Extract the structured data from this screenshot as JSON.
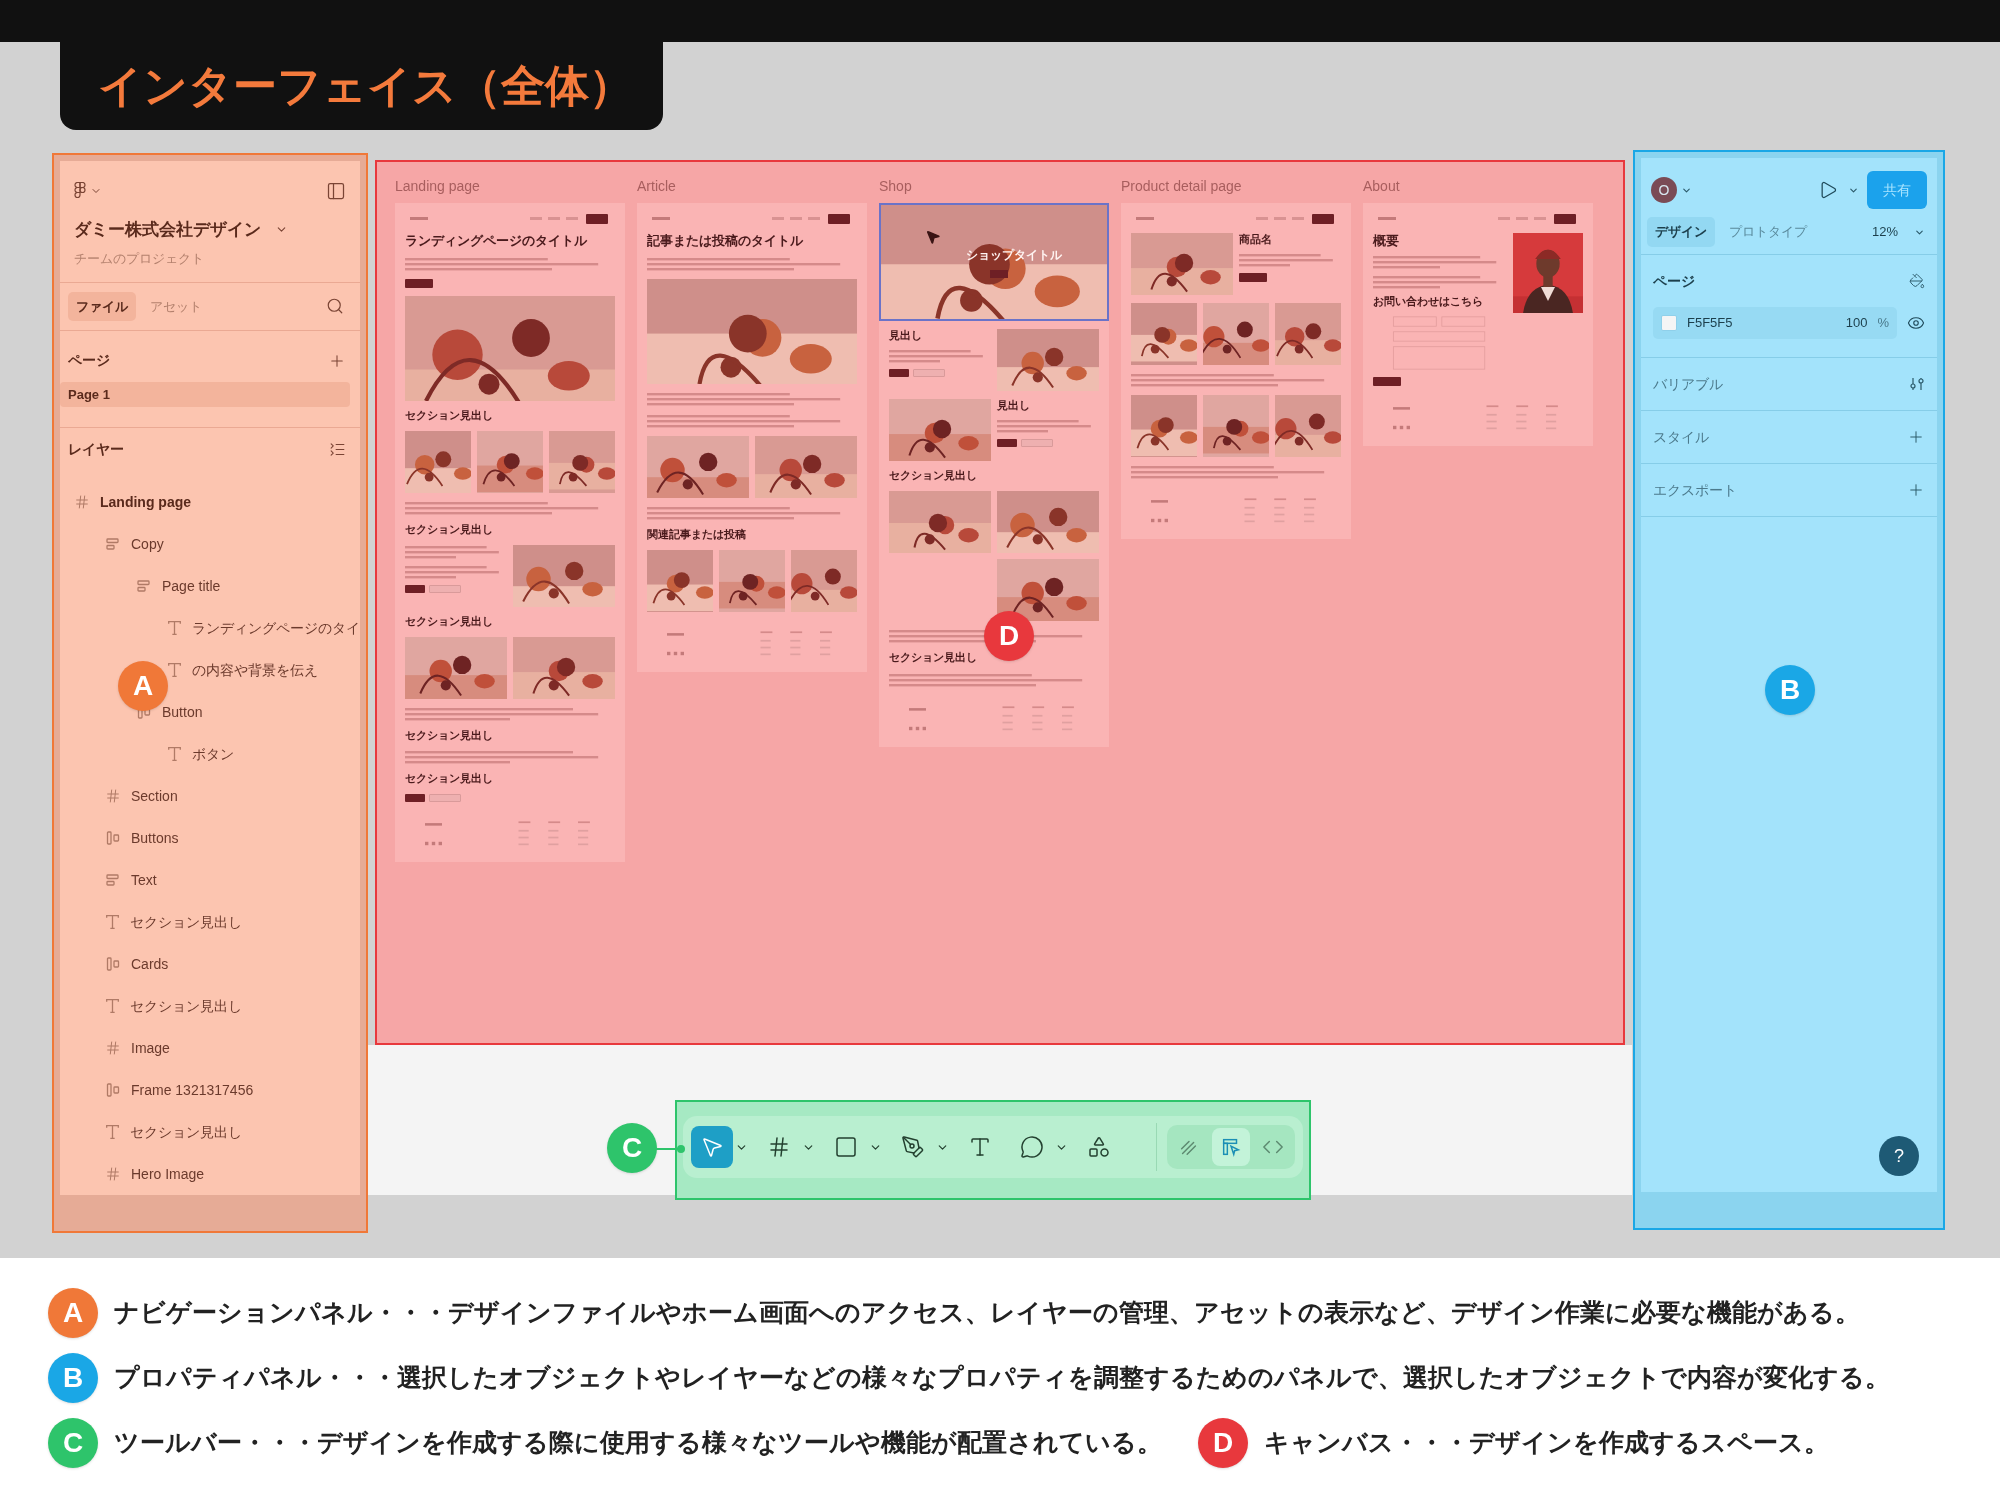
{
  "header": {
    "title": "インターフェイス（全体）"
  },
  "nav_panel": {
    "team": "ダミー株式会社デザイン",
    "project": "チームのプロジェクト",
    "tabs": [
      {
        "label": "ファイル",
        "selected": true
      },
      {
        "label": "アセット",
        "selected": false
      }
    ],
    "pages_title": "ページ",
    "pages": [
      {
        "label": "Page 1",
        "selected": true
      }
    ],
    "layers_title": "レイヤー",
    "layers": [
      {
        "name": "Landing page",
        "kind": "frame",
        "children": [
          {
            "name": "Copy",
            "kind": "stack",
            "children": [
              {
                "name": "Page title",
                "kind": "stack",
                "children": [
                  {
                    "name": "ランディングページのタイ",
                    "kind": "text"
                  },
                  {
                    "name": "の内容や背景を伝え",
                    "kind": "text"
                  }
                ]
              },
              {
                "name": "Button",
                "kind": "row",
                "children": [
                  {
                    "name": "ボタン",
                    "kind": "text"
                  }
                ]
              }
            ]
          },
          {
            "name": "Section",
            "kind": "frame"
          },
          {
            "name": "Buttons",
            "kind": "row"
          },
          {
            "name": "Text",
            "kind": "stack"
          },
          {
            "name": "セクション見出し",
            "kind": "text"
          },
          {
            "name": "Cards",
            "kind": "row"
          },
          {
            "name": "セクション見出し",
            "kind": "text"
          },
          {
            "name": "Image",
            "kind": "frame"
          },
          {
            "name": "Frame 1321317456",
            "kind": "row"
          },
          {
            "name": "セクション見出し",
            "kind": "text"
          },
          {
            "name": "Hero Image",
            "kind": "frame"
          }
        ]
      }
    ]
  },
  "canvas": {
    "frames": [
      {
        "label": "Landing page",
        "blocks": [
          {
            "kind": "nav"
          },
          {
            "kind": "title",
            "text": "ランディングページのタイトル"
          },
          {
            "kind": "text"
          },
          {
            "kind": "button"
          },
          {
            "kind": "picture"
          },
          {
            "kind": "heading",
            "text": "セクション見出し"
          },
          {
            "kind": "row",
            "items": [
              {
                "kind": "picture"
              },
              {
                "kind": "picture"
              },
              {
                "kind": "picture"
              }
            ]
          },
          {
            "kind": "text"
          },
          {
            "kind": "heading",
            "text": "セクション見出し"
          },
          {
            "kind": "row",
            "items": [
              {
                "kind": "column",
                "items": [
                  {
                    "kind": "text"
                  },
                  {
                    "kind": "text"
                  },
                  {
                    "kind": "buttons"
                  }
                ]
              },
              {
                "kind": "picture"
              }
            ]
          },
          {
            "kind": "heading",
            "text": "セクション見出し"
          },
          {
            "kind": "row",
            "items": [
              {
                "kind": "picture"
              },
              {
                "kind": "picture"
              }
            ]
          },
          {
            "kind": "text"
          },
          {
            "kind": "heading",
            "text": "セクション見出し"
          },
          {
            "kind": "text"
          },
          {
            "kind": "heading",
            "text": "セクション見出し"
          },
          {
            "kind": "buttons"
          },
          {
            "kind": "footer"
          }
        ]
      },
      {
        "label": "Article",
        "blocks": [
          {
            "kind": "nav"
          },
          {
            "kind": "title",
            "text": "記事または投稿のタイトル"
          },
          {
            "kind": "text"
          },
          {
            "kind": "picture"
          },
          {
            "kind": "text"
          },
          {
            "kind": "text"
          },
          {
            "kind": "row",
            "items": [
              {
                "kind": "picture"
              },
              {
                "kind": "picture"
              }
            ]
          },
          {
            "kind": "text"
          },
          {
            "kind": "heading",
            "text": "関連記事または投稿"
          },
          {
            "kind": "row",
            "items": [
              {
                "kind": "picture"
              },
              {
                "kind": "picture"
              },
              {
                "kind": "picture"
              }
            ]
          },
          {
            "kind": "footer"
          }
        ]
      },
      {
        "label": "Shop",
        "blocks": [
          {
            "kind": "hero",
            "text": "ショップタイトル",
            "selected": true
          },
          {
            "kind": "row",
            "items": [
              {
                "kind": "column",
                "items": [
                  {
                    "kind": "heading",
                    "text": "見出し"
                  },
                  {
                    "kind": "text"
                  },
                  {
                    "kind": "buttons"
                  }
                ]
              },
              {
                "kind": "picture"
              }
            ]
          },
          {
            "kind": "row",
            "items": [
              {
                "kind": "picture"
              },
              {
                "kind": "column",
                "items": [
                  {
                    "kind": "heading",
                    "text": "見出し"
                  },
                  {
                    "kind": "text"
                  },
                  {
                    "kind": "buttons"
                  }
                ]
              }
            ]
          },
          {
            "kind": "heading",
            "text": "セクション見出し"
          },
          {
            "kind": "row",
            "items": [
              {
                "kind": "picture"
              },
              {
                "kind": "column",
                "items": [
                  {
                    "kind": "picture"
                  },
                  {
                    "kind": "picture"
                  }
                ]
              }
            ]
          },
          {
            "kind": "text"
          },
          {
            "kind": "heading",
            "text": "セクション見出し"
          },
          {
            "kind": "text"
          },
          {
            "kind": "footer"
          }
        ]
      },
      {
        "label": "Product detail page",
        "blocks": [
          {
            "kind": "nav"
          },
          {
            "kind": "row",
            "items": [
              {
                "kind": "picture"
              },
              {
                "kind": "column",
                "items": [
                  {
                    "kind": "heading",
                    "text": "商品名"
                  },
                  {
                    "kind": "text"
                  },
                  {
                    "kind": "button"
                  }
                ]
              }
            ]
          },
          {
            "kind": "row",
            "items": [
              {
                "kind": "picture"
              },
              {
                "kind": "picture"
              },
              {
                "kind": "picture"
              }
            ]
          },
          {
            "kind": "text"
          },
          {
            "kind": "row",
            "items": [
              {
                "kind": "picture"
              },
              {
                "kind": "picture"
              },
              {
                "kind": "picture"
              }
            ]
          },
          {
            "kind": "text"
          },
          {
            "kind": "footer"
          }
        ]
      },
      {
        "label": "About",
        "blocks": [
          {
            "kind": "nav"
          },
          {
            "kind": "row",
            "items": [
              {
                "kind": "column",
                "items": [
                  {
                    "kind": "title",
                    "text": "概要"
                  },
                  {
                    "kind": "text"
                  },
                  {
                    "kind": "text"
                  },
                  {
                    "kind": "heading",
                    "text": "お問い合わせはこちら"
                  },
                  {
                    "kind": "form"
                  },
                  {
                    "kind": "button"
                  }
                ]
              },
              {
                "kind": "portrait"
              }
            ]
          },
          {
            "kind": "footer"
          }
        ]
      }
    ]
  },
  "toolbar": {
    "tools": [
      {
        "kind": "move",
        "selected": true,
        "menu": true
      },
      {
        "kind": "frame",
        "selected": false,
        "menu": true
      },
      {
        "kind": "shape",
        "selected": false,
        "menu": true
      },
      {
        "kind": "pen",
        "selected": false,
        "menu": true
      },
      {
        "kind": "text",
        "selected": false,
        "menu": false
      },
      {
        "kind": "comment",
        "selected": false,
        "menu": true
      },
      {
        "kind": "actions",
        "selected": false,
        "menu": false
      }
    ],
    "modes": [
      {
        "kind": "draw",
        "selected": false
      },
      {
        "kind": "design",
        "selected": true
      },
      {
        "kind": "dev",
        "selected": false
      }
    ]
  },
  "properties_panel": {
    "avatar": "O",
    "share": "共有",
    "tabs": [
      {
        "label": "デザイン",
        "selected": true
      },
      {
        "label": "プロトタイプ",
        "selected": false
      }
    ],
    "zoom": "12%",
    "page_section": {
      "title": "ページ",
      "color": "F5F5F5",
      "opacity": "100",
      "unit": "%"
    },
    "sections": [
      {
        "title": "バリアブル",
        "kind": "variables"
      },
      {
        "title": "スタイル",
        "kind": "add"
      },
      {
        "title": "エクスポート",
        "kind": "add"
      }
    ],
    "help": "?"
  },
  "callouts": [
    {
      "letter": "A",
      "color": "#f07838"
    },
    {
      "letter": "B",
      "color": "#1aa7e6"
    },
    {
      "letter": "C",
      "color": "#2ec46b"
    },
    {
      "letter": "D",
      "color": "#e8383d"
    }
  ],
  "legend": [
    {
      "entries": [
        {
          "letter": "A",
          "color": "#f07838",
          "text": "ナビゲーションパネル・・・デザインファイルやホーム画面へのアクセス、レイヤーの管理、アセットの表示など、デザイン作業に必要な機能がある。"
        }
      ]
    },
    {
      "entries": [
        {
          "letter": "B",
          "color": "#1aa7e6",
          "text": "プロパティパネル・・・選択したオブジェクトやレイヤーなどの様々なプロパティを調整するためのパネルで、選択したオブジェクトで内容が変化する。"
        }
      ]
    },
    {
      "entries": [
        {
          "letter": "C",
          "color": "#2ec46b",
          "text": "ツールバー・・・デザインを作成する際に使用する様々なツールや機能が配置されている。"
        },
        {
          "letter": "D",
          "color": "#e8383d",
          "text": "キャンバス・・・デザインを作成するスペース。"
        }
      ]
    }
  ]
}
